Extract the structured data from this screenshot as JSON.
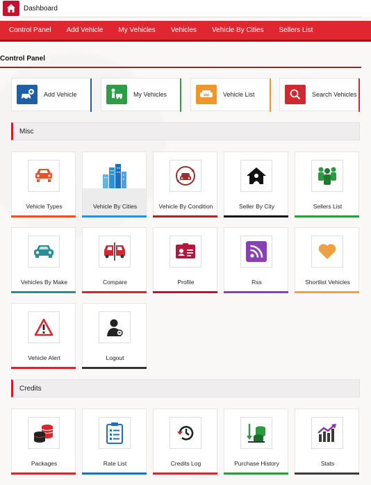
{
  "topbar": {
    "title": "Dashboard"
  },
  "nav": [
    "Control Panel",
    "Add Vehicle",
    "My Vehicles",
    "Vehicles",
    "Vehicle By Cities",
    "Sellers List"
  ],
  "page": {
    "title": "Control Panel"
  },
  "quick_actions": [
    {
      "label": "Add Vehicle",
      "icon": "car-plus-icon",
      "color": "#1e5fa8"
    },
    {
      "label": "My Vehicles",
      "icon": "person-car-icon",
      "color": "#2e9e46"
    },
    {
      "label": "Vehicle List",
      "icon": "car-list-icon",
      "color": "#f0962c"
    },
    {
      "label": "Search Vehicles",
      "icon": "search-icon",
      "color": "#d4272f"
    }
  ],
  "sections": {
    "misc": "Misc",
    "credits": "Credits"
  },
  "misc_tiles": [
    {
      "label": "Vehicle Types",
      "icon": "cars-icon",
      "color": "#e8532a"
    },
    {
      "label": "Vehicle By Cities",
      "icon": "city-buildings-icon",
      "color": "#2d8fd6"
    },
    {
      "label": "Vehicle By Condition",
      "icon": "car-refresh-icon",
      "color": "#9b2d2d"
    },
    {
      "label": "Seller By City",
      "icon": "house-person-icon",
      "color": "#111111"
    },
    {
      "label": "Sellers List",
      "icon": "group-people-icon",
      "color": "#2c9a41"
    },
    {
      "label": "Vehicles By Make",
      "icon": "car-front-icon",
      "color": "#2a8e96"
    },
    {
      "label": "Compare",
      "icon": "compare-cars-icon",
      "color": "#d02a30"
    },
    {
      "label": "Profile",
      "icon": "id-card-icon",
      "color": "#b5173d"
    },
    {
      "label": "Rss",
      "icon": "rss-icon",
      "color": "#8a3fb5"
    },
    {
      "label": "Shortlist Vehicles",
      "icon": "heart-icon",
      "color": "#f0a040"
    },
    {
      "label": "Vehicle Alert",
      "icon": "warning-icon",
      "color": "#d4272f"
    },
    {
      "label": "Logout",
      "icon": "user-logout-icon",
      "color": "#333333"
    }
  ],
  "credit_tiles": [
    {
      "label": "Packages",
      "icon": "coin-stacks-icon",
      "color": "#d4272f"
    },
    {
      "label": "Rate List",
      "icon": "clipboard-list-icon",
      "color": "#1e6fbd"
    },
    {
      "label": "Credits Log",
      "icon": "history-icon",
      "color": "#d4272f"
    },
    {
      "label": "Purchase History",
      "icon": "coins-arrow-icon",
      "color": "#2c9a41"
    },
    {
      "label": "Stats",
      "icon": "chart-growth-icon",
      "color": "#3a3a3a"
    }
  ]
}
